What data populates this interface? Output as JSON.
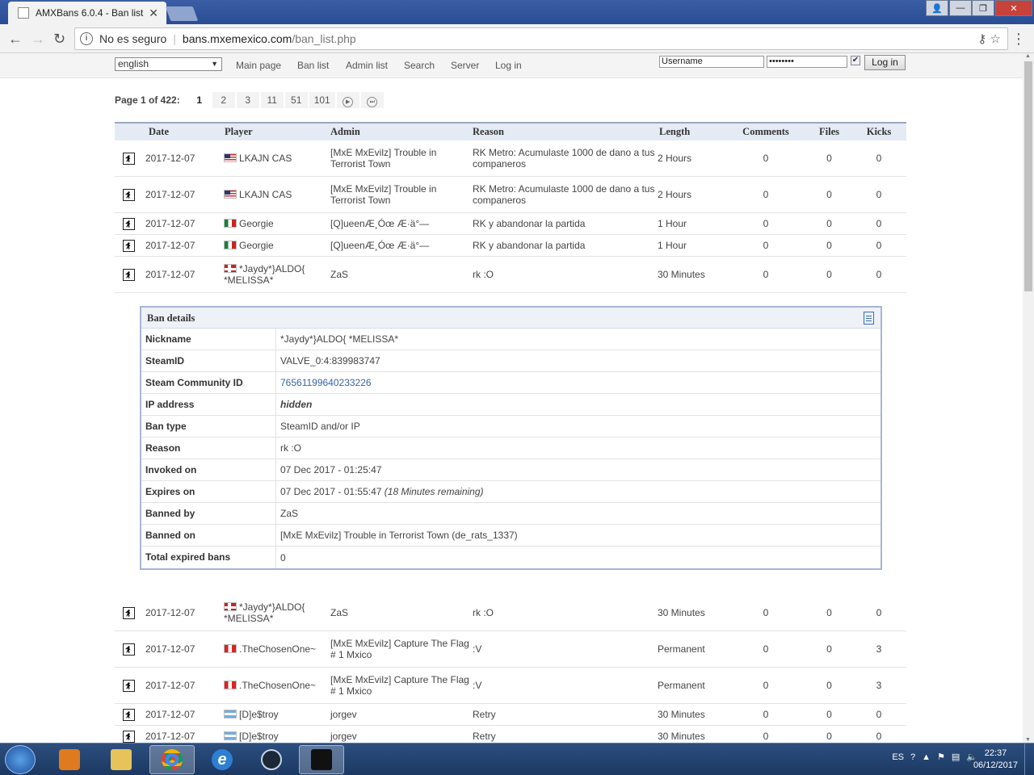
{
  "browser": {
    "tab_title": "AMXBans 6.0.4 - Ban list",
    "security_label": "No es seguro",
    "url_host": "bans.mxemexico.com",
    "url_path": "/ban_list.php"
  },
  "nav": {
    "language": "english",
    "links": [
      "Main page",
      "Ban list",
      "Admin list",
      "Search",
      "Server",
      "Log in"
    ],
    "username_value": "Username",
    "password_value": "••••••••",
    "remember_checked": true,
    "login_button": "Log in"
  },
  "pager": {
    "label": "Page 1 of 422:",
    "pages": [
      "1",
      "2",
      "3",
      "11",
      "51",
      "101"
    ],
    "current": "1"
  },
  "table": {
    "headers": [
      "Date",
      "Player",
      "Admin",
      "Reason",
      "Length",
      "Comments",
      "Files",
      "Kicks"
    ],
    "rows_top": [
      {
        "date": "2017-12-07",
        "flag": "us",
        "player": "LKAJN CAS",
        "admin": "[MxE MxEvilz] Trouble in Terrorist Town",
        "reason": "RK Metro: Acumulaste 1000 de dano a tus companeros",
        "length": "2 Hours",
        "comments": "0",
        "files": "0",
        "kicks": "0"
      },
      {
        "date": "2017-12-07",
        "flag": "us",
        "player": "LKAJN CAS",
        "admin": "[MxE MxEvilz] Trouble in Terrorist Town",
        "reason": "RK Metro: Acumulaste 1000 de dano a tus companeros",
        "length": "2 Hours",
        "comments": "0",
        "files": "0",
        "kicks": "0"
      },
      {
        "date": "2017-12-07",
        "flag": "mx",
        "player": "Georgie",
        "admin": "[Q]ueenÆ¸Óœ Æ·ä°—",
        "reason": "RK y abandonar la partida",
        "length": "1 Hour",
        "comments": "0",
        "files": "0",
        "kicks": "0"
      },
      {
        "date": "2017-12-07",
        "flag": "mx",
        "player": "Georgie",
        "admin": "[Q]ueenÆ¸Óœ Æ·ä°—",
        "reason": "RK y abandonar la partida",
        "length": "1 Hour",
        "comments": "0",
        "files": "0",
        "kicks": "0"
      },
      {
        "date": "2017-12-07",
        "flag": "no",
        "player": "*Jaydy*}ALDO{ *MELISSA*",
        "admin": "ZaS",
        "reason": "rk :O",
        "length": "30 Minutes",
        "comments": "0",
        "files": "0",
        "kicks": "0"
      }
    ],
    "rows_bottom": [
      {
        "date": "2017-12-07",
        "flag": "no",
        "player": "*Jaydy*}ALDO{ *MELISSA*",
        "admin": "ZaS",
        "reason": "rk :O",
        "length": "30 Minutes",
        "comments": "0",
        "files": "0",
        "kicks": "0"
      },
      {
        "date": "2017-12-07",
        "flag": "pe",
        "player": ".TheChosenOne~",
        "admin": "[MxE MxEvilz] Capture The Flag # 1 Mxico",
        "reason": ":V",
        "length": "Permanent",
        "comments": "0",
        "files": "0",
        "kicks": "3"
      },
      {
        "date": "2017-12-07",
        "flag": "pe",
        "player": ".TheChosenOne~",
        "admin": "[MxE MxEvilz] Capture The Flag # 1 Mxico",
        "reason": ":V",
        "length": "Permanent",
        "comments": "0",
        "files": "0",
        "kicks": "3"
      },
      {
        "date": "2017-12-07",
        "flag": "ar",
        "player": "[D]e$troy",
        "admin": "jorgev",
        "reason": "Retry",
        "length": "30 Minutes",
        "comments": "0",
        "files": "0",
        "kicks": "0"
      },
      {
        "date": "2017-12-07",
        "flag": "ar",
        "player": "[D]e$troy",
        "admin": "jorgev",
        "reason": "Retry",
        "length": "30 Minutes",
        "comments": "0",
        "files": "0",
        "kicks": "0"
      }
    ]
  },
  "details": {
    "title": "Ban details",
    "nickname_label": "Nickname",
    "nickname": "*Jaydy*}ALDO{ *MELISSA*",
    "steamid_label": "SteamID",
    "steamid": "VALVE_0:4:839983747",
    "community_label": "Steam Community ID",
    "community": "76561199640233226",
    "ip_label": "IP address",
    "ip": "hidden",
    "bantype_label": "Ban type",
    "bantype": "SteamID and/or IP",
    "reason_label": "Reason",
    "reason": "rk :O",
    "invoked_label": "Invoked on",
    "invoked": "07 Dec 2017 - 01:25:47",
    "expires_label": "Expires on",
    "expires": "07 Dec 2017 - 01:55:47",
    "expires_note": "(18 Minutes remaining)",
    "bannedby_label": "Banned by",
    "bannedby": "ZaS",
    "bannedon_label": "Banned on",
    "bannedon": "[MxE MxEvilz] Trouble in Terrorist Town (de_rats_1337)",
    "expired_label": "Total expired bans",
    "expired": "0"
  },
  "taskbar": {
    "lang": "ES",
    "time": "22:37",
    "date": "06/12/2017"
  }
}
